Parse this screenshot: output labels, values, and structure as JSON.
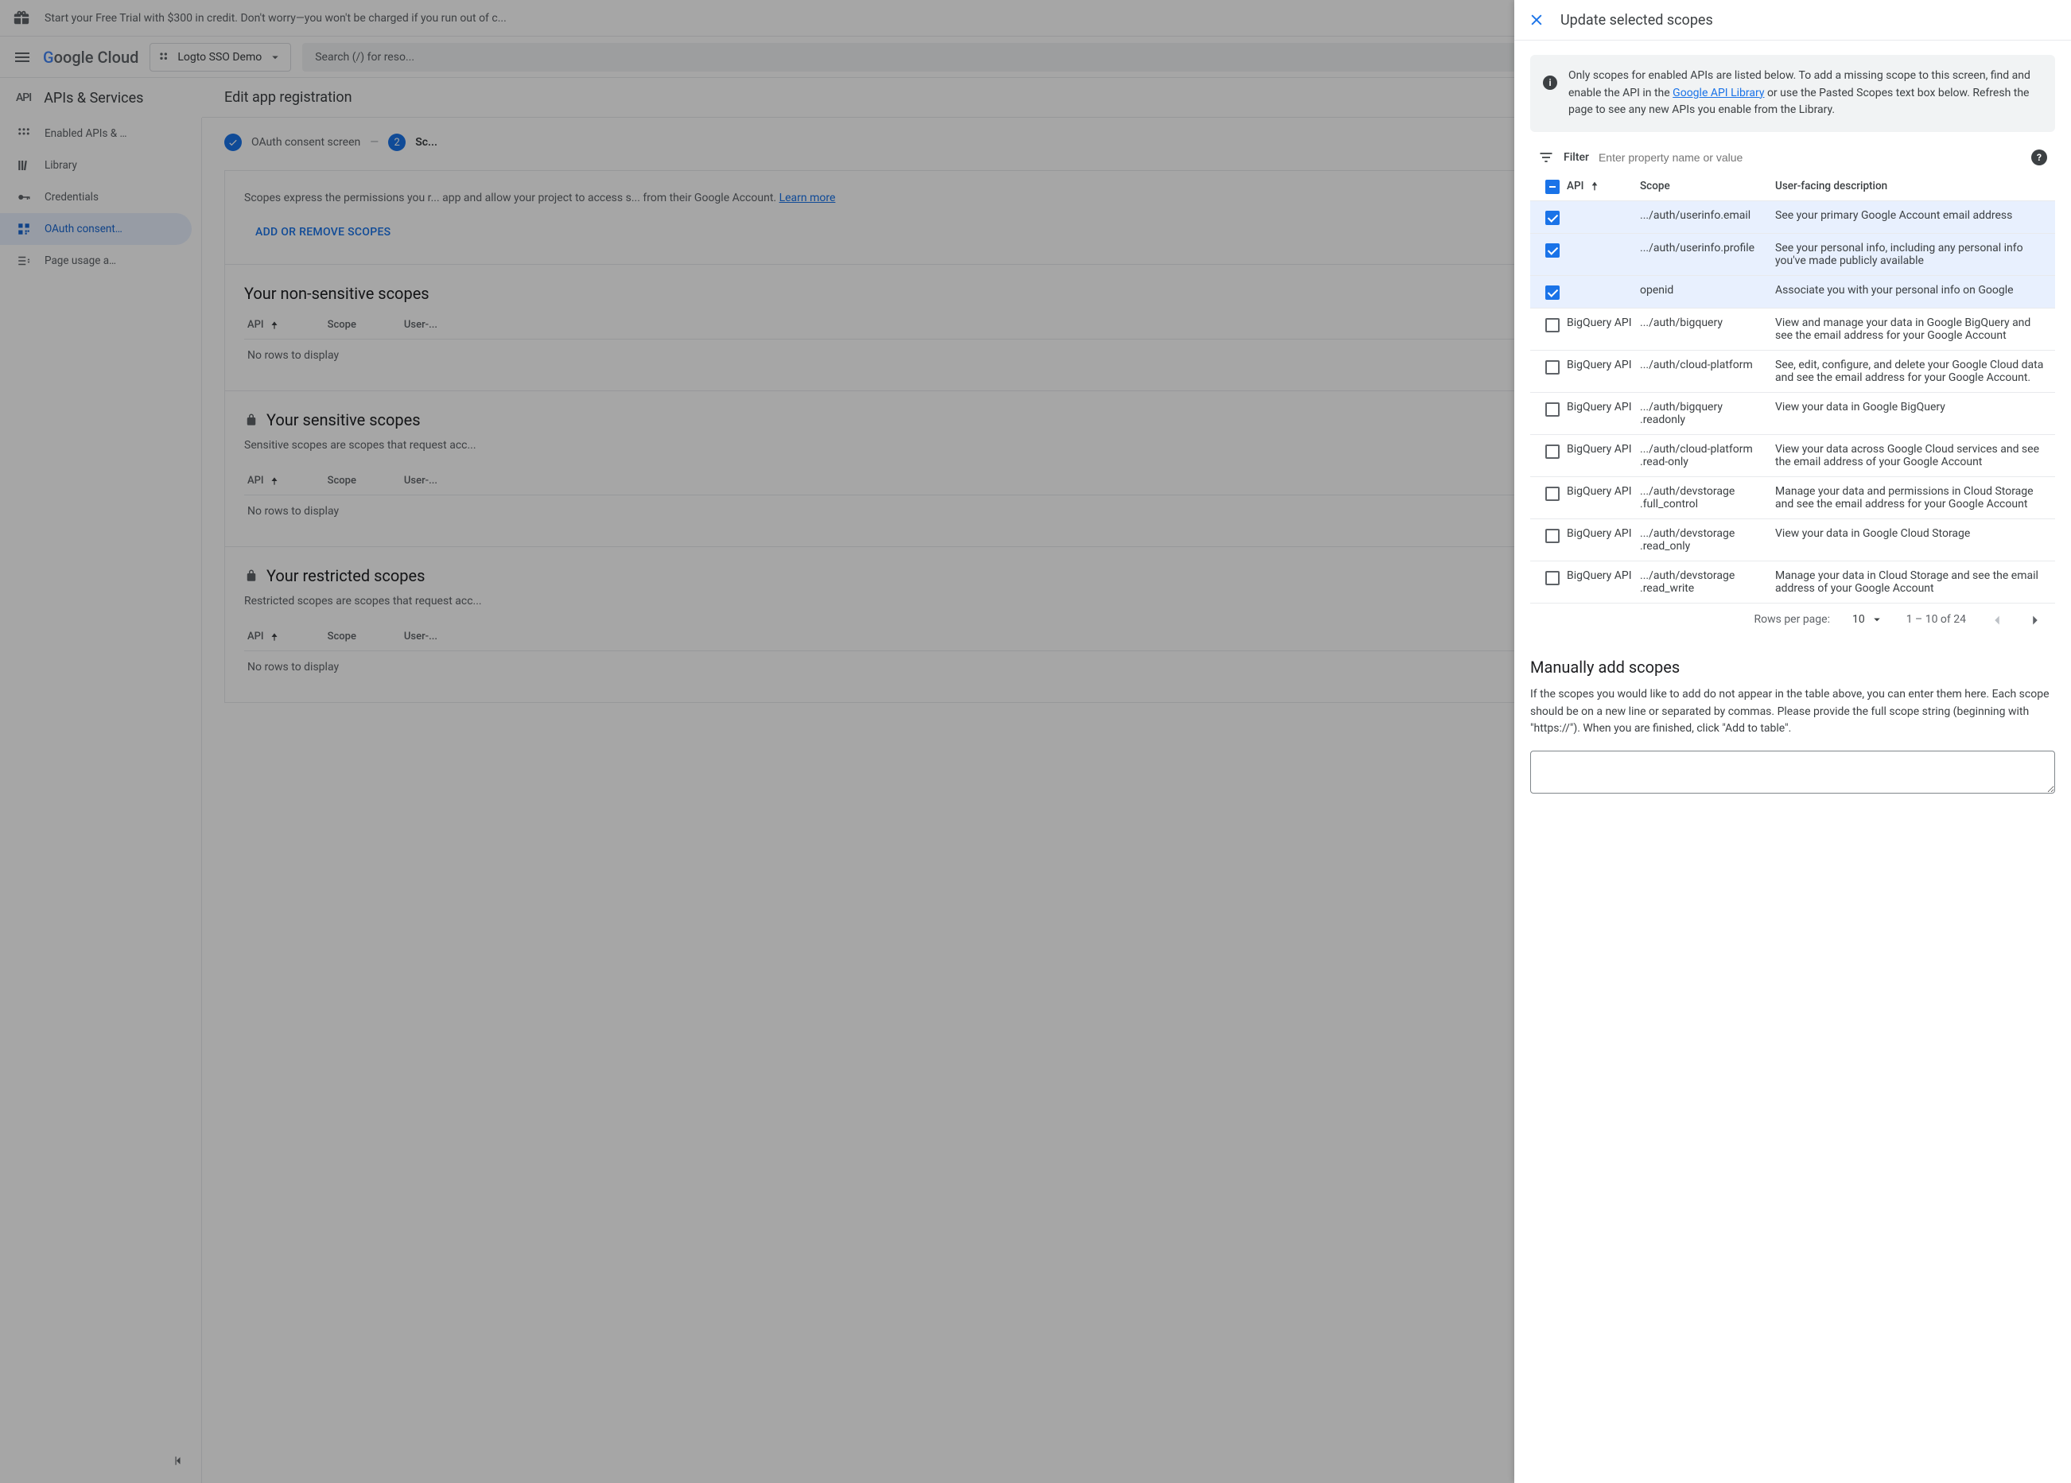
{
  "banner": {
    "text": "Start your Free Trial with $300 in credit. Don't worry—you won't be charged if you run out of c..."
  },
  "header": {
    "logo_cloud": "oogle Cloud",
    "project": "Logto SSO Demo",
    "search_placeholder": "Search (/) for reso..."
  },
  "nav": {
    "title": "APIs & Services",
    "items": [
      {
        "icon": "dashboard",
        "label": "Enabled APIs & …"
      },
      {
        "icon": "library",
        "label": "Library"
      },
      {
        "icon": "key",
        "label": "Credentials"
      },
      {
        "icon": "consent",
        "label": "OAuth consent…",
        "active": true
      },
      {
        "icon": "usage",
        "label": "Page usage a…"
      }
    ]
  },
  "content": {
    "title": "Edit app registration",
    "stepper": {
      "step1": "OAuth consent screen",
      "step2_num": "2",
      "step2_label": "Sc..."
    },
    "scopes_desc": "Scopes express the permissions you r... app and allow your project to access s... from their Google Account.",
    "learn_more": "Learn more",
    "add_remove_btn": "ADD OR REMOVE SCOPES",
    "nonsensitive_title": "Your non-sensitive scopes",
    "sensitive_title": "Your sensitive scopes",
    "sensitive_desc": "Sensitive scopes are scopes that request acc...",
    "restricted_title": "Your restricted scopes",
    "restricted_desc": "Restricted scopes are scopes that request acc...",
    "th_api": "API",
    "th_scope": "Scope",
    "th_user": "User-...",
    "empty": "No rows to display"
  },
  "drawer": {
    "title": "Update selected scopes",
    "info_before": "Only scopes for enabled APIs are listed below. To add a missing scope to this screen, find and enable the API in the ",
    "info_link": "Google API Library",
    "info_after": " or use the Pasted Scopes text box below. Refresh the page to see any new APIs you enable from the Library.",
    "filter_label": "Filter",
    "filter_placeholder": "Enter property name or value",
    "th_api": "API",
    "th_scope": "Scope",
    "th_desc": "User-facing description",
    "rows": [
      {
        "checked": true,
        "api": "",
        "scope": ".../auth/userinfo.email",
        "desc": "See your primary Google Account email address"
      },
      {
        "checked": true,
        "api": "",
        "scope": ".../auth/userinfo.profile",
        "desc": "See your personal info, including any personal info you've made publicly available"
      },
      {
        "checked": true,
        "api": "",
        "scope": "openid",
        "desc": "Associate you with your personal info on Google"
      },
      {
        "checked": false,
        "api": "BigQuery API",
        "scope": ".../auth/bigquery",
        "desc": "View and manage your data in Google BigQuery and see the email address for your Google Account"
      },
      {
        "checked": false,
        "api": "BigQuery API",
        "scope": ".../auth/cloud-platform",
        "desc": "See, edit, configure, and delete your Google Cloud data and see the email address for your Google Account."
      },
      {
        "checked": false,
        "api": "BigQuery API",
        "scope": ".../auth/bigquery .readonly",
        "desc": "View your data in Google BigQuery"
      },
      {
        "checked": false,
        "api": "BigQuery API",
        "scope": ".../auth/cloud-platform .read-only",
        "desc": "View your data across Google Cloud services and see the email address of your Google Account"
      },
      {
        "checked": false,
        "api": "BigQuery API",
        "scope": ".../auth/devstorage .full_control",
        "desc": "Manage your data and permissions in Cloud Storage and see the email address for your Google Account"
      },
      {
        "checked": false,
        "api": "BigQuery API",
        "scope": ".../auth/devstorage .read_only",
        "desc": "View your data in Google Cloud Storage"
      },
      {
        "checked": false,
        "api": "BigQuery API",
        "scope": ".../auth/devstorage .read_write",
        "desc": "Manage your data in Cloud Storage and see the email address of your Google Account"
      }
    ],
    "pager": {
      "rows_label": "Rows per page:",
      "rows_value": "10",
      "range": "1 – 10 of 24"
    },
    "manual_title": "Manually add scopes",
    "manual_desc": "If the scopes you would like to add do not appear in the table above, you can enter them here. Each scope should be on a new line or separated by commas. Please provide the full scope string (beginning with \"https://\"). When you are finished, click \"Add to table\"."
  }
}
